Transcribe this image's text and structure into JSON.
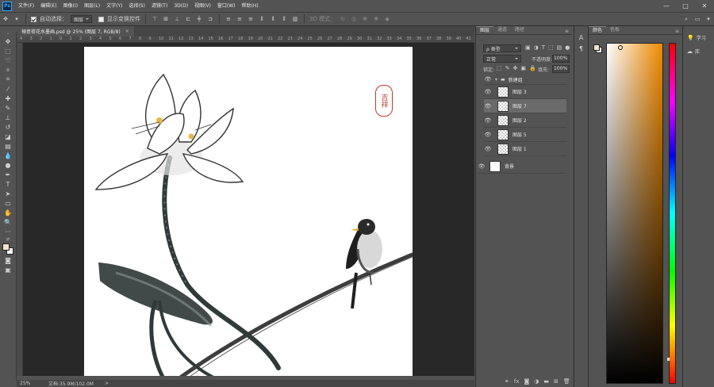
{
  "menubar": {
    "logo": "Ps",
    "items": [
      "文件(F)",
      "编辑(E)",
      "图像(I)",
      "图层(L)",
      "文字(Y)",
      "选择(S)",
      "滤镜(T)",
      "3D(D)",
      "视图(V)",
      "窗口(W)",
      "帮助(H)"
    ],
    "win_controls": [
      "—",
      "□",
      "✕"
    ]
  },
  "options": {
    "auto_select_label": "自动选择：",
    "auto_select_value": "图层",
    "show_transform_label": "显示变换控件",
    "mode_3d_label": "3D 模式："
  },
  "document": {
    "tab_title": "禅意荷花水墨画.psd @ 25% (图层 7, RGB/8)",
    "close_glyph": "×",
    "ruler_ticks": [
      "4",
      "3",
      "2",
      "1",
      "0",
      "1",
      "2",
      "3",
      "4",
      "5",
      "6",
      "7",
      "8",
      "9",
      "10",
      "11",
      "12",
      "13",
      "14",
      "15",
      "16",
      "17",
      "18",
      "19",
      "20",
      "21",
      "22",
      "23",
      "24",
      "25",
      "26",
      "27",
      "28",
      "29",
      "30",
      "31",
      "32",
      "33",
      "34",
      "35",
      "36",
      "37",
      "38",
      "39",
      "40",
      "41"
    ]
  },
  "status": {
    "zoom": "25%",
    "doc_size": "文档:35.9M/102.0M",
    "arrow": ">"
  },
  "layers_panel": {
    "tabs": [
      "图层",
      "通道",
      "路径"
    ],
    "filter_label": "ρ 类型",
    "blend_mode": "正常",
    "opacity_label": "不透明度:",
    "opacity_value": "100%",
    "lock_label": "锁定:",
    "fill_label": "填充:",
    "fill_value": "100%",
    "group_name": "新建组",
    "layers": [
      "图层 3",
      "图层 7",
      "图层 2",
      "图层 5",
      "图层 1",
      "背景"
    ],
    "selected_layer": "图层 7",
    "bottom_icons": [
      "link-icon",
      "fx-icon",
      "mask-icon",
      "adjustment-icon",
      "folder-icon",
      "new-layer-icon",
      "trash-icon"
    ]
  },
  "mini_panel": {
    "icons": [
      "character-icon",
      "paragraph-icon"
    ]
  },
  "color_panel": {
    "tabs": [
      "颜色",
      "色板"
    ],
    "foreground": "#f5e3c8",
    "background": "#ffffff",
    "picker_hue": "#f08a00"
  },
  "learn_panel": {
    "learn_label": "学习",
    "library_label": "库"
  },
  "canvas": {
    "seal_text": "吉祥"
  }
}
